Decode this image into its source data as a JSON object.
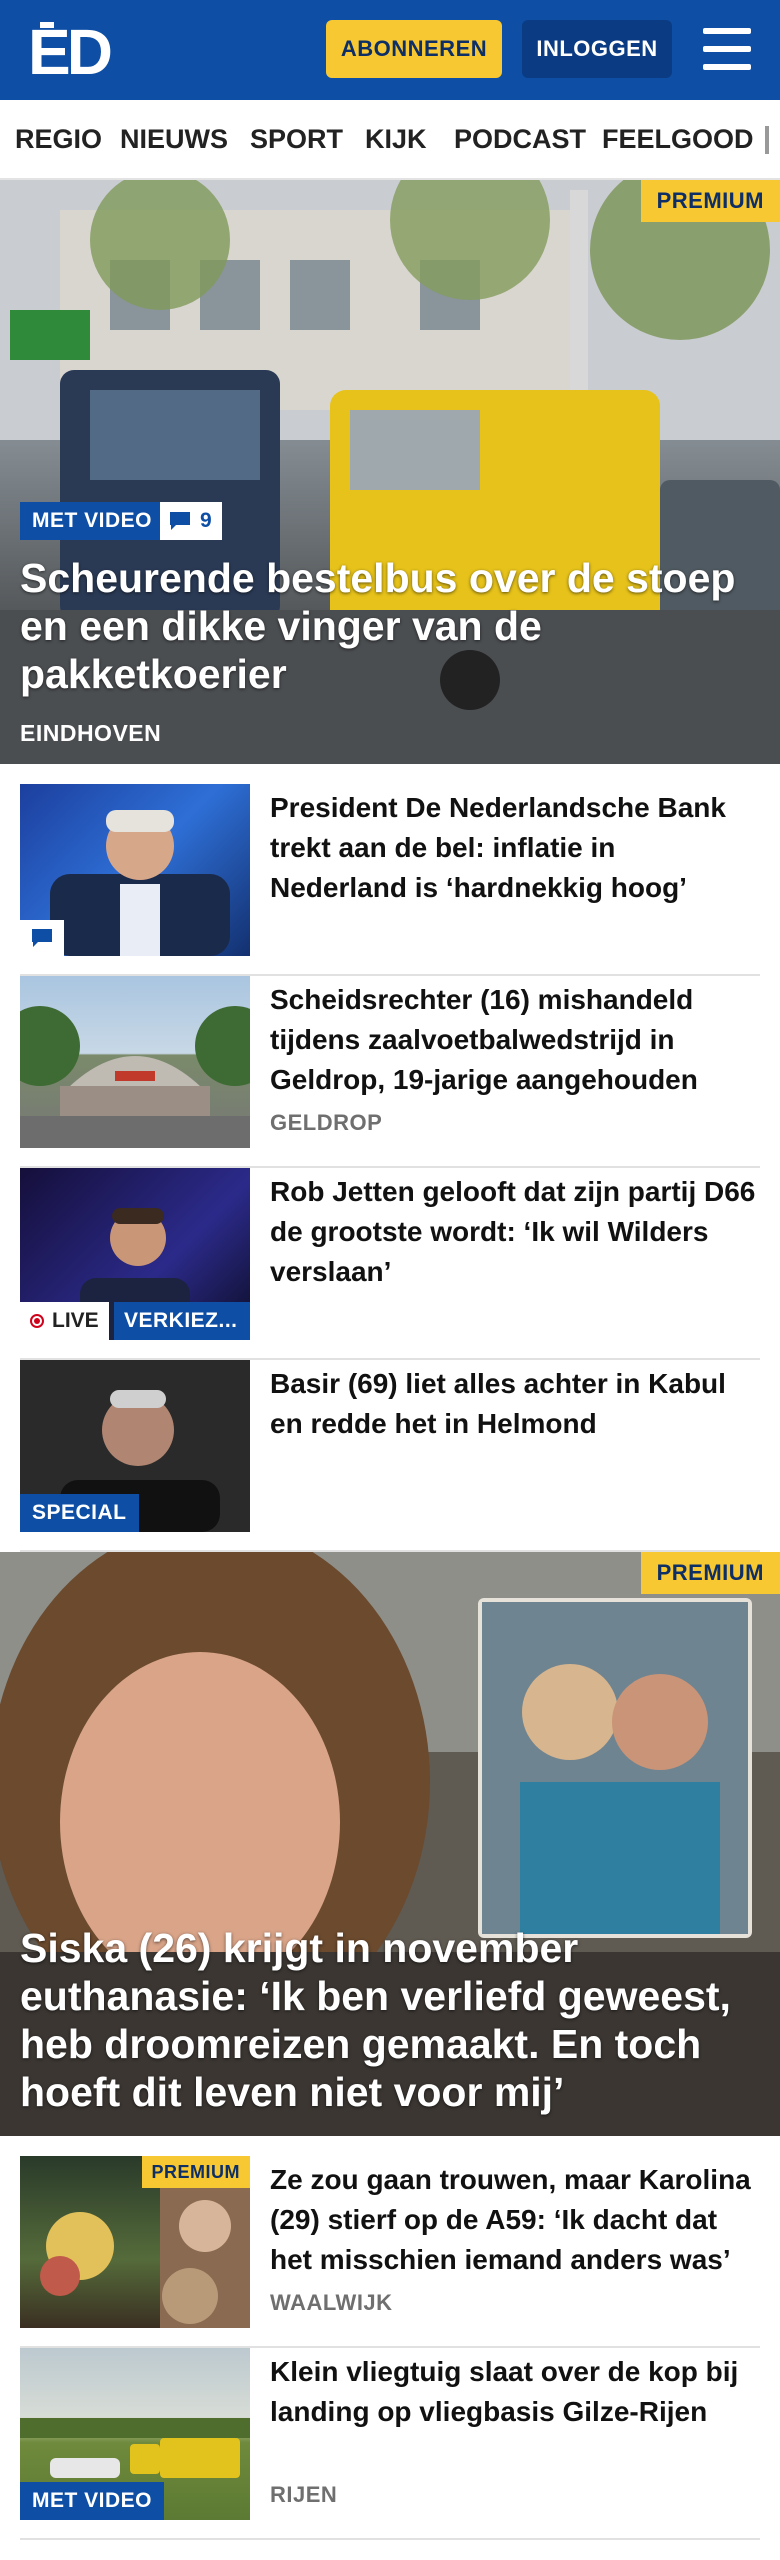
{
  "header": {
    "logo_text": "ED",
    "subscribe_label": "ABONNEREN",
    "login_label": "INLOGGEN",
    "colors": {
      "brand_blue": "#0e4fa5",
      "accent_yellow": "#f7c832"
    }
  },
  "nav": {
    "items": [
      "REGIO",
      "NIEUWS",
      "SPORT",
      "KIJK",
      "PODCAST",
      "FEELGOOD"
    ]
  },
  "hero1": {
    "premium": "PREMIUM",
    "video_tag": "MET VIDEO",
    "comment_count": "9",
    "title": "Scheurende bestelbus over de stoep en een dikke vinger van de pakketkoe­rier",
    "city": "EINDHOVEN"
  },
  "articles": [
    {
      "title": "President De Nederlandsche Bank trekt aan de bel: inflatie in Nederland is ‘hardnekkig hoog’",
      "icon": "comment-icon"
    },
    {
      "title": "Scheidsrechter (16) mishandeld tijdens zaalvoetbalwedstrijd in Geldrop, 19-jarige aangehouden",
      "city": "GELDROP"
    },
    {
      "title": "Rob Jetten gelooft dat zijn partij D66 de grootste wordt: ‘Ik wil Wilders verslaan’",
      "live": "LIVE",
      "section": "VERKIEZ..."
    },
    {
      "title": "Basir (69) liet alles achter in Kabul en redde het in Helmond",
      "badge": "SPECIAL"
    }
  ],
  "hero2": {
    "premium": "PREMIUM",
    "title": "Siska (26) krijgt in november euthanasie: ‘Ik ben verliefd geweest, heb droomreizen gemaakt. En toch hoeft dit leven niet voor mij’"
  },
  "articles2": [
    {
      "title": "Ze zou gaan trouwen, maar Karolina (29) stierf op de A59: ‘Ik dacht dat het misschien iemand anders was’",
      "city": "WAALWIJK",
      "premium": "PREMIUM"
    },
    {
      "title": "Klein vliegtuig slaat over de kop bij landing op vliegbasis Gilze-Rijen",
      "city": "RIJEN",
      "badge": "MET VIDEO"
    }
  ]
}
